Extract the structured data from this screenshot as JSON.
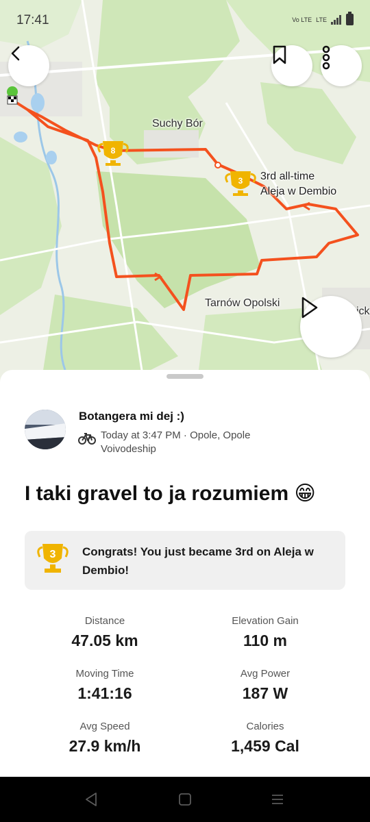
{
  "status_bar": {
    "time": "17:41",
    "volte_label": "Vo LTE",
    "network_label": "LTE"
  },
  "map": {
    "places": {
      "suchy_bor": "Suchy Bór",
      "tarnow": "Tarnów Opolski",
      "cut": "ick"
    },
    "segment_label": {
      "line1": "3rd all-time",
      "line2": "Aleja w Dembio"
    },
    "trophies": {
      "first": "8",
      "second": "3"
    },
    "colors": {
      "route": "#f4511e",
      "trophy": "#f0b400"
    }
  },
  "activity": {
    "athlete_name": "Botangera mi dej :)",
    "meta": "Today at 3:47 PM · Opole, Opole Voivodeship",
    "title": "I taki gravel to ja rozumiem 😁",
    "achievement": {
      "rank": "3",
      "text": "Congrats! You just became 3rd on Aleja w Dembio!"
    },
    "stats": [
      {
        "label": "Distance",
        "value": "47.05 km"
      },
      {
        "label": "Elevation Gain",
        "value": "110 m"
      },
      {
        "label": "Moving Time",
        "value": "1:41:16"
      },
      {
        "label": "Avg Power",
        "value": "187 W"
      },
      {
        "label": "Avg Speed",
        "value": "27.9 km/h"
      },
      {
        "label": "Calories",
        "value": "1,459 Cal"
      }
    ]
  },
  "icons": [
    "back-chevron-icon",
    "bookmark-icon",
    "more-vertical-icon",
    "play-icon",
    "bike-icon",
    "trophy-icon",
    "back-triangle-icon",
    "home-square-icon",
    "menu-lines-icon"
  ]
}
